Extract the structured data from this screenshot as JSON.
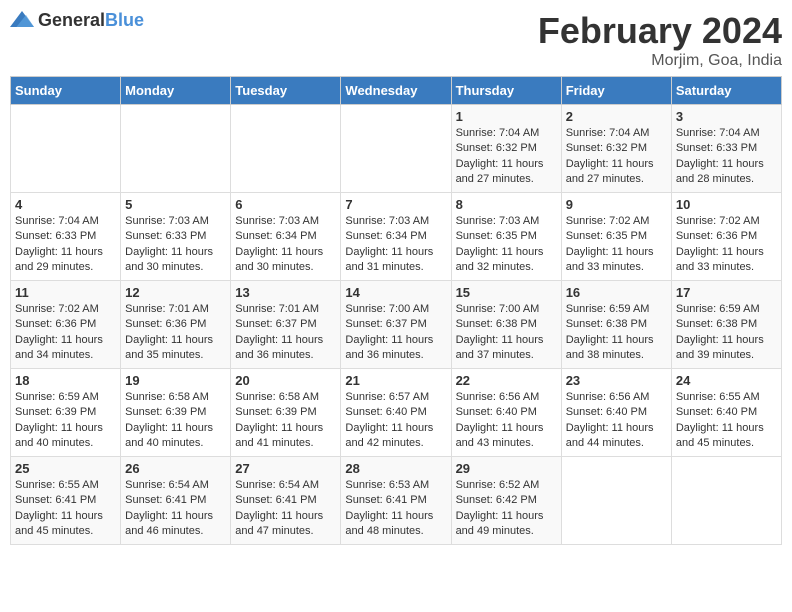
{
  "header": {
    "logo_general": "General",
    "logo_blue": "Blue",
    "month": "February 2024",
    "location": "Morjim, Goa, India"
  },
  "days_of_week": [
    "Sunday",
    "Monday",
    "Tuesday",
    "Wednesday",
    "Thursday",
    "Friday",
    "Saturday"
  ],
  "weeks": [
    [
      {
        "day": "",
        "info": ""
      },
      {
        "day": "",
        "info": ""
      },
      {
        "day": "",
        "info": ""
      },
      {
        "day": "",
        "info": ""
      },
      {
        "day": "1",
        "sunrise": "7:04 AM",
        "sunset": "6:32 PM",
        "daylight": "11 hours and 27 minutes."
      },
      {
        "day": "2",
        "sunrise": "7:04 AM",
        "sunset": "6:32 PM",
        "daylight": "11 hours and 27 minutes."
      },
      {
        "day": "3",
        "sunrise": "7:04 AM",
        "sunset": "6:33 PM",
        "daylight": "11 hours and 28 minutes."
      }
    ],
    [
      {
        "day": "4",
        "sunrise": "7:04 AM",
        "sunset": "6:33 PM",
        "daylight": "11 hours and 29 minutes."
      },
      {
        "day": "5",
        "sunrise": "7:03 AM",
        "sunset": "6:33 PM",
        "daylight": "11 hours and 30 minutes."
      },
      {
        "day": "6",
        "sunrise": "7:03 AM",
        "sunset": "6:34 PM",
        "daylight": "11 hours and 30 minutes."
      },
      {
        "day": "7",
        "sunrise": "7:03 AM",
        "sunset": "6:34 PM",
        "daylight": "11 hours and 31 minutes."
      },
      {
        "day": "8",
        "sunrise": "7:03 AM",
        "sunset": "6:35 PM",
        "daylight": "11 hours and 32 minutes."
      },
      {
        "day": "9",
        "sunrise": "7:02 AM",
        "sunset": "6:35 PM",
        "daylight": "11 hours and 33 minutes."
      },
      {
        "day": "10",
        "sunrise": "7:02 AM",
        "sunset": "6:36 PM",
        "daylight": "11 hours and 33 minutes."
      }
    ],
    [
      {
        "day": "11",
        "sunrise": "7:02 AM",
        "sunset": "6:36 PM",
        "daylight": "11 hours and 34 minutes."
      },
      {
        "day": "12",
        "sunrise": "7:01 AM",
        "sunset": "6:36 PM",
        "daylight": "11 hours and 35 minutes."
      },
      {
        "day": "13",
        "sunrise": "7:01 AM",
        "sunset": "6:37 PM",
        "daylight": "11 hours and 36 minutes."
      },
      {
        "day": "14",
        "sunrise": "7:00 AM",
        "sunset": "6:37 PM",
        "daylight": "11 hours and 36 minutes."
      },
      {
        "day": "15",
        "sunrise": "7:00 AM",
        "sunset": "6:38 PM",
        "daylight": "11 hours and 37 minutes."
      },
      {
        "day": "16",
        "sunrise": "6:59 AM",
        "sunset": "6:38 PM",
        "daylight": "11 hours and 38 minutes."
      },
      {
        "day": "17",
        "sunrise": "6:59 AM",
        "sunset": "6:38 PM",
        "daylight": "11 hours and 39 minutes."
      }
    ],
    [
      {
        "day": "18",
        "sunrise": "6:59 AM",
        "sunset": "6:39 PM",
        "daylight": "11 hours and 40 minutes."
      },
      {
        "day": "19",
        "sunrise": "6:58 AM",
        "sunset": "6:39 PM",
        "daylight": "11 hours and 40 minutes."
      },
      {
        "day": "20",
        "sunrise": "6:58 AM",
        "sunset": "6:39 PM",
        "daylight": "11 hours and 41 minutes."
      },
      {
        "day": "21",
        "sunrise": "6:57 AM",
        "sunset": "6:40 PM",
        "daylight": "11 hours and 42 minutes."
      },
      {
        "day": "22",
        "sunrise": "6:56 AM",
        "sunset": "6:40 PM",
        "daylight": "11 hours and 43 minutes."
      },
      {
        "day": "23",
        "sunrise": "6:56 AM",
        "sunset": "6:40 PM",
        "daylight": "11 hours and 44 minutes."
      },
      {
        "day": "24",
        "sunrise": "6:55 AM",
        "sunset": "6:40 PM",
        "daylight": "11 hours and 45 minutes."
      }
    ],
    [
      {
        "day": "25",
        "sunrise": "6:55 AM",
        "sunset": "6:41 PM",
        "daylight": "11 hours and 45 minutes."
      },
      {
        "day": "26",
        "sunrise": "6:54 AM",
        "sunset": "6:41 PM",
        "daylight": "11 hours and 46 minutes."
      },
      {
        "day": "27",
        "sunrise": "6:54 AM",
        "sunset": "6:41 PM",
        "daylight": "11 hours and 47 minutes."
      },
      {
        "day": "28",
        "sunrise": "6:53 AM",
        "sunset": "6:41 PM",
        "daylight": "11 hours and 48 minutes."
      },
      {
        "day": "29",
        "sunrise": "6:52 AM",
        "sunset": "6:42 PM",
        "daylight": "11 hours and 49 minutes."
      },
      {
        "day": "",
        "info": ""
      },
      {
        "day": "",
        "info": ""
      }
    ]
  ]
}
